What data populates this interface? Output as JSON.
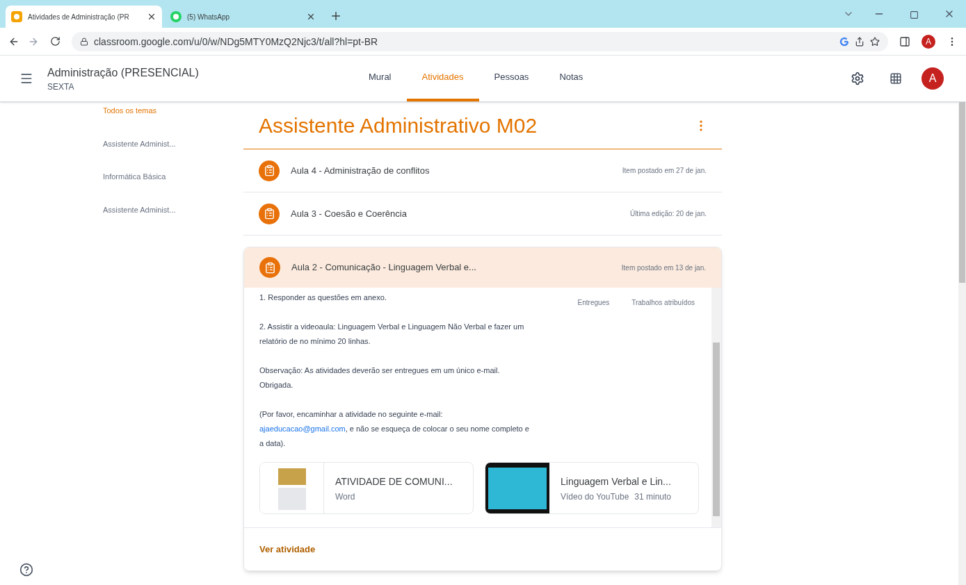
{
  "browser": {
    "tabs": [
      {
        "title": "Atividades de Administração (PR",
        "selected": true,
        "kind": "classroom"
      },
      {
        "title": "(5) WhatsApp",
        "selected": false,
        "kind": "whatsapp"
      }
    ],
    "url": "classroom.google.com/u/0/w/NDg5MTY0MzQ2Njc3/t/all?hl=pt-BR",
    "profile": "A"
  },
  "header": {
    "course": "Administração (PRESENCIAL)",
    "section": "SEXTA",
    "nav": [
      {
        "label": "Mural",
        "selected": false
      },
      {
        "label": "Atividades",
        "selected": true
      },
      {
        "label": "Pessoas",
        "selected": false
      },
      {
        "label": "Notas",
        "selected": false
      }
    ],
    "avatar": "A"
  },
  "topics": [
    {
      "label": "Todos os temas",
      "selected": true
    },
    {
      "label": "Assistente Administ...",
      "selected": false
    },
    {
      "label": "Informática Básica",
      "selected": false
    },
    {
      "label": "Assistente Administ...",
      "selected": false
    }
  ],
  "topic_title": "Assistente Administrativo M02",
  "items": [
    {
      "title": "Aula 4 - Administração de conflitos",
      "meta": "Item postado em 27 de jan.",
      "expanded": false
    },
    {
      "title": "Aula 3 - Coesão e Coerência",
      "meta": "Última edição: 20 de jan.",
      "expanded": false
    },
    {
      "title": "Aula 2 - Comunicação - Linguagem Verbal e...",
      "meta": "Item postado em 13 de jan.",
      "expanded": true
    }
  ],
  "expanded": {
    "paragraphs": [
      {
        "kind": "text",
        "text": "1. Responder as questões em anexo."
      },
      {
        "kind": "text",
        "text": "2. Assistir a videoaula: Linguagem Verbal e Linguagem Não Verbal e fazer um relatório de no mínimo 20 linhas."
      },
      {
        "kind": "text",
        "text": "Observação: As atividades deverão ser entregues em um único e-mail. Obrigada."
      },
      {
        "kind": "email",
        "before": "(Por favor, encaminhar a atividade no seguinte e-mail:",
        "link": "ajaeducacao@gmail.com",
        "after": ", e não se esqueça de colocar o seu nome completo e a data)."
      }
    ],
    "stats": [
      {
        "label": "Entregues"
      },
      {
        "label": "Trabalhos atribuídos"
      }
    ],
    "attachments": [
      {
        "kind": "document",
        "title": "ATIVIDADE DE COMUNI...",
        "subtitle": "Word"
      },
      {
        "kind": "video",
        "title": "Linguagem Verbal e Lin...",
        "subtitle": "Vídeo do YouTube",
        "duration": "31 minuto"
      }
    ],
    "action": "Ver atividade"
  }
}
